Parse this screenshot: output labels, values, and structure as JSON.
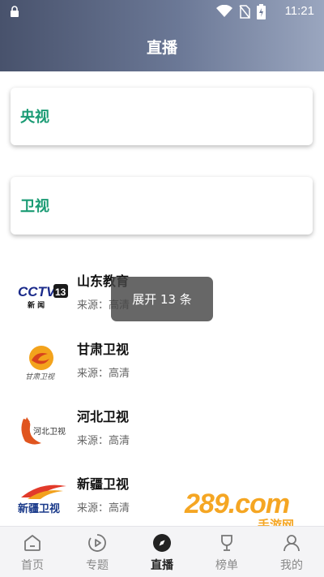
{
  "status_bar": {
    "time": "11:21",
    "icons": [
      "lock-icon",
      "wifi-icon",
      "no-sim-icon",
      "battery-charging-icon"
    ]
  },
  "header": {
    "title": "直播"
  },
  "categories": [
    {
      "label": "央视"
    },
    {
      "label": "卫视"
    }
  ],
  "channels": [
    {
      "name": "山东教育",
      "source": "来源：高清",
      "logo": "cctv13-logo"
    },
    {
      "name": "甘肃卫视",
      "source": "来源：高清",
      "logo": "gansu-tv-logo"
    },
    {
      "name": "河北卫视",
      "source": "来源：高清",
      "logo": "hebei-tv-logo"
    },
    {
      "name": "新疆卫视",
      "source": "来源：高清",
      "logo": "xinjiang-tv-logo"
    }
  ],
  "logos": {
    "cctv_number": "13",
    "cctv_sub": "新 闻",
    "gansu_text": "甘肃卫视",
    "hebei_text": "河北卫视",
    "xinjiang_text": "新疆卫视"
  },
  "toast": {
    "text": "展开 13 条"
  },
  "tabbar": {
    "tabs": [
      {
        "label": "首页",
        "icon": "home-icon",
        "active": false
      },
      {
        "label": "专题",
        "icon": "play-circle-icon",
        "active": false
      },
      {
        "label": "直播",
        "icon": "compass-icon",
        "active": true
      },
      {
        "label": "榜单",
        "icon": "trophy-icon",
        "active": false
      },
      {
        "label": "我的",
        "icon": "user-icon",
        "active": false
      }
    ]
  },
  "watermark": {
    "text": "289.com",
    "sub": "手游网"
  },
  "colors": {
    "accent": "#1a9b74",
    "header_start": "#48526c",
    "header_end": "#9aa6bf"
  }
}
